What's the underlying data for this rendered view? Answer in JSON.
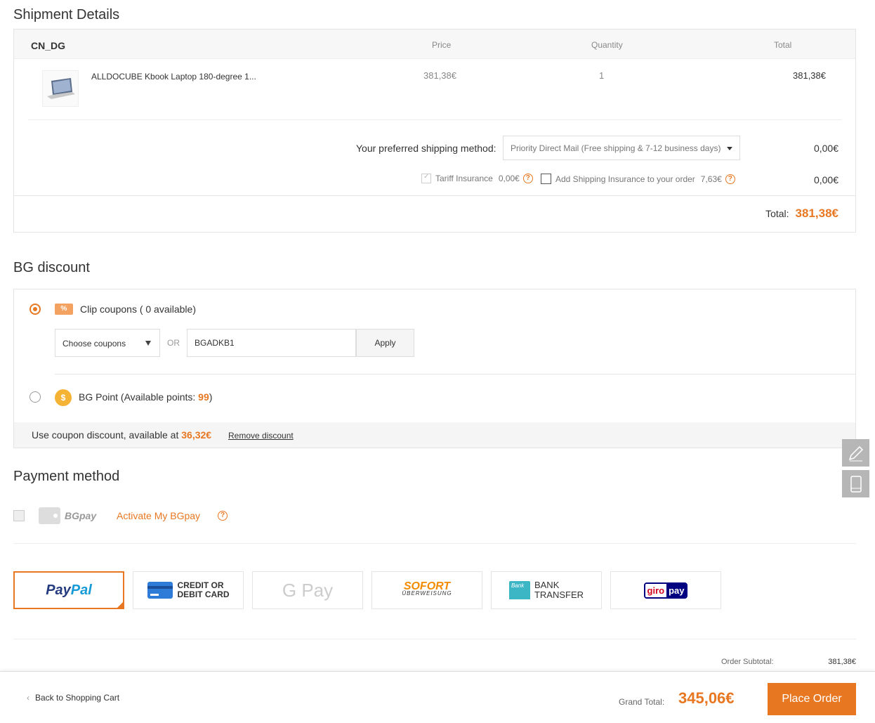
{
  "shipment": {
    "title": "Shipment Details",
    "warehouse": "CN_DG",
    "col_price": "Price",
    "col_quantity": "Quantity",
    "col_total": "Total",
    "product": {
      "name": "ALLDOCUBE Kbook Laptop 180-degree 1...",
      "price": "381,38€",
      "quantity": "1",
      "total": "381,38€"
    },
    "shipping_method_label": "Your preferred shipping method:",
    "shipping_method_value": "Priority Direct Mail (Free shipping & 7-12 business days)",
    "shipping_fee": "0,00€",
    "tariff_label": "Tariff Insurance",
    "tariff_fee": "0,00€",
    "shipping_insurance_label": "Add Shipping Insurance to your order",
    "shipping_insurance_fee": "7,63€",
    "insurance_row_fee": "0,00€",
    "total_label": "Total:",
    "total_value": "381,38€"
  },
  "discount": {
    "title": "BG discount",
    "coupon_icon_text": "%",
    "clip_label": "Clip coupons ( 0 available)",
    "choose_placeholder": "Choose coupons",
    "or_text": "OR",
    "coupon_code": "BGADKB1",
    "apply_label": "Apply",
    "coin_symbol": "$",
    "point_label_prefix": "BG Point (Available points: ",
    "point_value": "99",
    "point_label_suffix": ")",
    "footer_text": "Use coupon discount, available at ",
    "footer_amount": "36,32€",
    "remove_label": "Remove discount"
  },
  "payment": {
    "title": "Payment method",
    "bgpay_label": "BGpay",
    "activate_label": "Activate My BGpay",
    "help_symbol": "?",
    "methods": {
      "paypal_a": "Pay",
      "paypal_b": "Pal",
      "card_line1": "CREDIT OR",
      "card_line2": "DEBIT CARD",
      "gpay": "G Pay",
      "sofort_line1": "SOFORT",
      "sofort_line2": "ÜBERWEISUNG",
      "bank_line1": "BANK",
      "bank_line2": "TRANSFER",
      "giro_a": "giro",
      "giro_b": "pay"
    }
  },
  "summary": {
    "subtotal_label": "Order Subtotal:",
    "subtotal_value": "381,38€",
    "back_label": "Back to Shopping Cart",
    "grand_label": "Grand Total:",
    "grand_value": "345,06€",
    "place_order_label": "Place Order"
  },
  "colors": {
    "accent": "#e87722",
    "paypal_dark": "#253b80",
    "paypal_light": "#179bd7"
  },
  "icons": {
    "tools": [
      "pencil-icon",
      "mobile-icon"
    ]
  }
}
